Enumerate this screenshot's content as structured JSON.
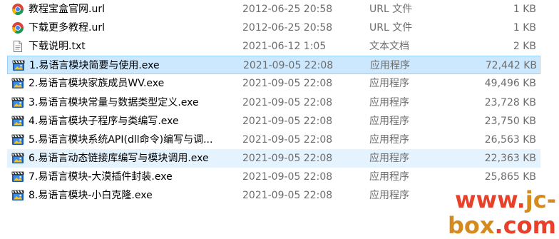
{
  "colors": {
    "selected_bg": "#cce8ff",
    "selected_border": "#99d1ff",
    "hover_bg": "#e5f3ff",
    "watermark_red": "#e8402a",
    "watermark_gold": "#d48a1e",
    "meta_text": "#6d6d6d"
  },
  "files": [
    {
      "name": "教程宝盒官网.url",
      "date": "2012-06-25 20:58",
      "type": "URL 文件",
      "size": "1 KB",
      "icon": "chrome-icon",
      "state": "normal"
    },
    {
      "name": "下载更多教程.url",
      "date": "2012-06-25 20:58",
      "type": "URL 文件",
      "size": "1 KB",
      "icon": "chrome-icon",
      "state": "normal"
    },
    {
      "name": "下载说明.txt",
      "date": "2021-06-12 1:05",
      "type": "文本文档",
      "size": "2 KB",
      "icon": "text-document-icon",
      "state": "normal"
    },
    {
      "name": "1.易语言模块简要与使用.exe",
      "date": "2021-09-05 22:08",
      "type": "应用程序",
      "size": "72,442 KB",
      "icon": "video-app-icon",
      "state": "selected"
    },
    {
      "name": "2.易语言模块家族成员WV.exe",
      "date": "2021-09-05 22:08",
      "type": "应用程序",
      "size": "49,496 KB",
      "icon": "video-app-icon",
      "state": "normal"
    },
    {
      "name": "3.易语言模块常量与数据类型定义.exe",
      "date": "2021-09-05 22:08",
      "type": "应用程序",
      "size": "23,728 KB",
      "icon": "video-app-icon",
      "state": "normal"
    },
    {
      "name": "4.易语言模块子程序与类编写.exe",
      "date": "2021-09-05 22:08",
      "type": "应用程序",
      "size": "23,750 KB",
      "icon": "video-app-icon",
      "state": "normal"
    },
    {
      "name": "5.易语言模块系统API(dll命令)编写与调...",
      "date": "2021-09-05 22:08",
      "type": "应用程序",
      "size": "26,563 KB",
      "icon": "video-app-icon",
      "state": "normal"
    },
    {
      "name": "6.易语言动态链接库编写与模块调用.exe",
      "date": "2021-09-05 22:08",
      "type": "应用程序",
      "size": "22,363 KB",
      "icon": "video-app-icon",
      "state": "hover"
    },
    {
      "name": "7.易语言模块-大漠插件封装.exe",
      "date": "2021-09-05 22:08",
      "type": "应用程序",
      "size": "25,865 KB",
      "icon": "video-app-icon",
      "state": "normal"
    },
    {
      "name": "8.易语言模块-小白克隆.exe",
      "date": "2021-09-05 22:08",
      "type": "应用程序",
      "size": "",
      "icon": "video-app-icon",
      "state": "normal"
    }
  ],
  "watermark": {
    "prefix": "www.",
    "middle": "jc-box",
    "suffix": ".com"
  }
}
